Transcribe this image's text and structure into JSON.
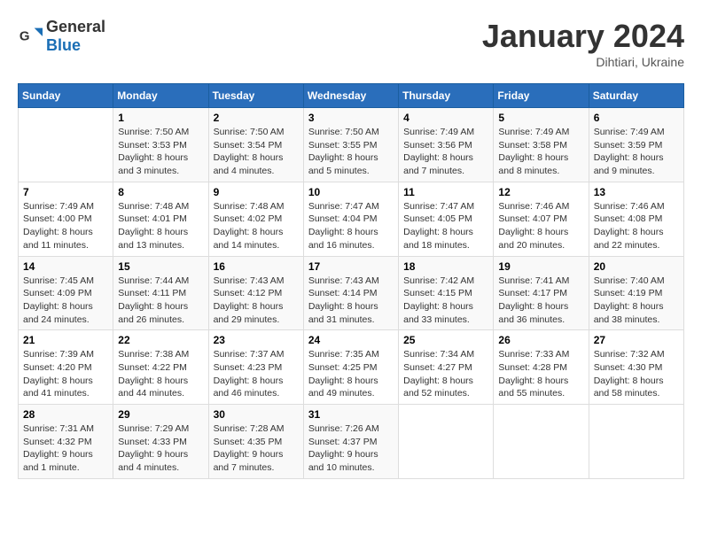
{
  "header": {
    "logo_general": "General",
    "logo_blue": "Blue",
    "month_year": "January 2024",
    "location": "Dihtiari, Ukraine"
  },
  "weekdays": [
    "Sunday",
    "Monday",
    "Tuesday",
    "Wednesday",
    "Thursday",
    "Friday",
    "Saturday"
  ],
  "weeks": [
    [
      {
        "day": "",
        "info": ""
      },
      {
        "day": "1",
        "info": "Sunrise: 7:50 AM\nSunset: 3:53 PM\nDaylight: 8 hours\nand 3 minutes."
      },
      {
        "day": "2",
        "info": "Sunrise: 7:50 AM\nSunset: 3:54 PM\nDaylight: 8 hours\nand 4 minutes."
      },
      {
        "day": "3",
        "info": "Sunrise: 7:50 AM\nSunset: 3:55 PM\nDaylight: 8 hours\nand 5 minutes."
      },
      {
        "day": "4",
        "info": "Sunrise: 7:49 AM\nSunset: 3:56 PM\nDaylight: 8 hours\nand 7 minutes."
      },
      {
        "day": "5",
        "info": "Sunrise: 7:49 AM\nSunset: 3:58 PM\nDaylight: 8 hours\nand 8 minutes."
      },
      {
        "day": "6",
        "info": "Sunrise: 7:49 AM\nSunset: 3:59 PM\nDaylight: 8 hours\nand 9 minutes."
      }
    ],
    [
      {
        "day": "7",
        "info": "Sunrise: 7:49 AM\nSunset: 4:00 PM\nDaylight: 8 hours\nand 11 minutes."
      },
      {
        "day": "8",
        "info": "Sunrise: 7:48 AM\nSunset: 4:01 PM\nDaylight: 8 hours\nand 13 minutes."
      },
      {
        "day": "9",
        "info": "Sunrise: 7:48 AM\nSunset: 4:02 PM\nDaylight: 8 hours\nand 14 minutes."
      },
      {
        "day": "10",
        "info": "Sunrise: 7:47 AM\nSunset: 4:04 PM\nDaylight: 8 hours\nand 16 minutes."
      },
      {
        "day": "11",
        "info": "Sunrise: 7:47 AM\nSunset: 4:05 PM\nDaylight: 8 hours\nand 18 minutes."
      },
      {
        "day": "12",
        "info": "Sunrise: 7:46 AM\nSunset: 4:07 PM\nDaylight: 8 hours\nand 20 minutes."
      },
      {
        "day": "13",
        "info": "Sunrise: 7:46 AM\nSunset: 4:08 PM\nDaylight: 8 hours\nand 22 minutes."
      }
    ],
    [
      {
        "day": "14",
        "info": "Sunrise: 7:45 AM\nSunset: 4:09 PM\nDaylight: 8 hours\nand 24 minutes."
      },
      {
        "day": "15",
        "info": "Sunrise: 7:44 AM\nSunset: 4:11 PM\nDaylight: 8 hours\nand 26 minutes."
      },
      {
        "day": "16",
        "info": "Sunrise: 7:43 AM\nSunset: 4:12 PM\nDaylight: 8 hours\nand 29 minutes."
      },
      {
        "day": "17",
        "info": "Sunrise: 7:43 AM\nSunset: 4:14 PM\nDaylight: 8 hours\nand 31 minutes."
      },
      {
        "day": "18",
        "info": "Sunrise: 7:42 AM\nSunset: 4:15 PM\nDaylight: 8 hours\nand 33 minutes."
      },
      {
        "day": "19",
        "info": "Sunrise: 7:41 AM\nSunset: 4:17 PM\nDaylight: 8 hours\nand 36 minutes."
      },
      {
        "day": "20",
        "info": "Sunrise: 7:40 AM\nSunset: 4:19 PM\nDaylight: 8 hours\nand 38 minutes."
      }
    ],
    [
      {
        "day": "21",
        "info": "Sunrise: 7:39 AM\nSunset: 4:20 PM\nDaylight: 8 hours\nand 41 minutes."
      },
      {
        "day": "22",
        "info": "Sunrise: 7:38 AM\nSunset: 4:22 PM\nDaylight: 8 hours\nand 44 minutes."
      },
      {
        "day": "23",
        "info": "Sunrise: 7:37 AM\nSunset: 4:23 PM\nDaylight: 8 hours\nand 46 minutes."
      },
      {
        "day": "24",
        "info": "Sunrise: 7:35 AM\nSunset: 4:25 PM\nDaylight: 8 hours\nand 49 minutes."
      },
      {
        "day": "25",
        "info": "Sunrise: 7:34 AM\nSunset: 4:27 PM\nDaylight: 8 hours\nand 52 minutes."
      },
      {
        "day": "26",
        "info": "Sunrise: 7:33 AM\nSunset: 4:28 PM\nDaylight: 8 hours\nand 55 minutes."
      },
      {
        "day": "27",
        "info": "Sunrise: 7:32 AM\nSunset: 4:30 PM\nDaylight: 8 hours\nand 58 minutes."
      }
    ],
    [
      {
        "day": "28",
        "info": "Sunrise: 7:31 AM\nSunset: 4:32 PM\nDaylight: 9 hours\nand 1 minute."
      },
      {
        "day": "29",
        "info": "Sunrise: 7:29 AM\nSunset: 4:33 PM\nDaylight: 9 hours\nand 4 minutes."
      },
      {
        "day": "30",
        "info": "Sunrise: 7:28 AM\nSunset: 4:35 PM\nDaylight: 9 hours\nand 7 minutes."
      },
      {
        "day": "31",
        "info": "Sunrise: 7:26 AM\nSunset: 4:37 PM\nDaylight: 9 hours\nand 10 minutes."
      },
      {
        "day": "",
        "info": ""
      },
      {
        "day": "",
        "info": ""
      },
      {
        "day": "",
        "info": ""
      }
    ]
  ]
}
